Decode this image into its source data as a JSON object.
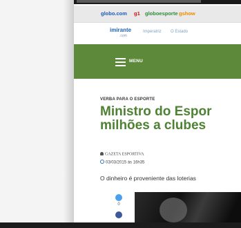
{
  "portal_bar": {
    "items": [
      "globo.com",
      "g1",
      "globoesporte",
      "gshow"
    ],
    "colors": [
      "#1e58b8",
      "#c4170c",
      "#2e8b3a",
      "#f08a00"
    ]
  },
  "partner_bar": {
    "logo_main": "imirante",
    "logo_sub": ".com",
    "links": [
      "Imperatriz",
      "O Estado"
    ]
  },
  "header": {
    "menu_label": "MENU",
    "brand_color": "#5d8a3a"
  },
  "article": {
    "kicker": "VERBA PARA O ESPORTE",
    "headline_line1": "Ministro do Espor",
    "headline_line2": "milhões a clubes",
    "author": "GAZETA ESPORTIVA",
    "date": "03/03/2015 às 16h35",
    "lead": "O dinheiro é proveniente das loterias",
    "share_count": "0"
  },
  "icons": [
    "menu-icon",
    "person-icon",
    "clock-icon",
    "twitter-icon",
    "facebook-icon"
  ]
}
